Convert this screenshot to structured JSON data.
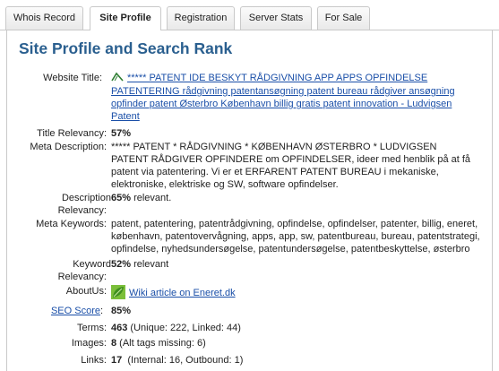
{
  "tabs": [
    {
      "label": "Whois Record"
    },
    {
      "label": "Site Profile"
    },
    {
      "label": "Registration"
    },
    {
      "label": "Server Stats"
    },
    {
      "label": "For Sale"
    }
  ],
  "heading": "Site Profile and Search Rank",
  "website_title": {
    "label": "Website Title:",
    "link_text": "***** PATENT IDE BESKYT RÅDGIVNING APP APPS OPFINDELSE PATENTERING rådgivning patentansøgning patent bureau rådgiver ansøgning opfinder patent Østerbro København billig gratis patent innovation - Ludvigsen Patent"
  },
  "title_relevancy": {
    "label": "Title Relevancy:",
    "value": "57%"
  },
  "meta_description": {
    "label": "Meta Description:",
    "value": "***** PATENT * RÅDGIVNING * KØBENHAVN ØSTERBRO * LUDVIGSEN PATENT RÅDGIVER OPFINDERE om OPFINDELSER, ideer med henblik på at få patent via patentering. Vi er et ERFARENT PATENT BUREAU i mekaniske, elektroniske, elektriske og SW, software opfindelser."
  },
  "description_relevancy": {
    "label_line1": "Description",
    "label_line2": "Relevancy:",
    "value_bold": "65%",
    "value_rest": " relevant."
  },
  "meta_keywords": {
    "label": "Meta Keywords:",
    "value": "patent, patentering, patentrådgivning, opfindelse, opfindelser, patenter, billig, eneret, københavn, patentovervågning, apps, app, sw, patentbureau, bureau, patentstrategi, opfindelse, nyhedsundersøgelse, patentundersøgelse, patentbeskyttelse, østerbro"
  },
  "keyword_relevancy": {
    "label_line1": "Keyword",
    "label_line2": "Relevancy:",
    "value_bold": "52%",
    "value_rest": " relevant"
  },
  "about_us": {
    "label": "AboutUs:",
    "link_text": "Wiki article on Eneret.dk"
  },
  "seo_score": {
    "label": "SEO Score",
    "value": "85%"
  },
  "terms": {
    "label": "Terms:",
    "value_bold": "463",
    "value_rest": " (Unique: 222, Linked: 44)"
  },
  "images": {
    "label": "Images:",
    "value_bold": "8",
    "value_rest": " (Alt tags missing: 6)"
  },
  "links": {
    "label": "Links:",
    "value_bold": "17",
    "value_rest": "  (Internal: 16, Outbound: 1)"
  },
  "colors": {
    "heading": "#2a5f8f",
    "link": "#1a4fa8",
    "border": "#c9c9c9"
  }
}
